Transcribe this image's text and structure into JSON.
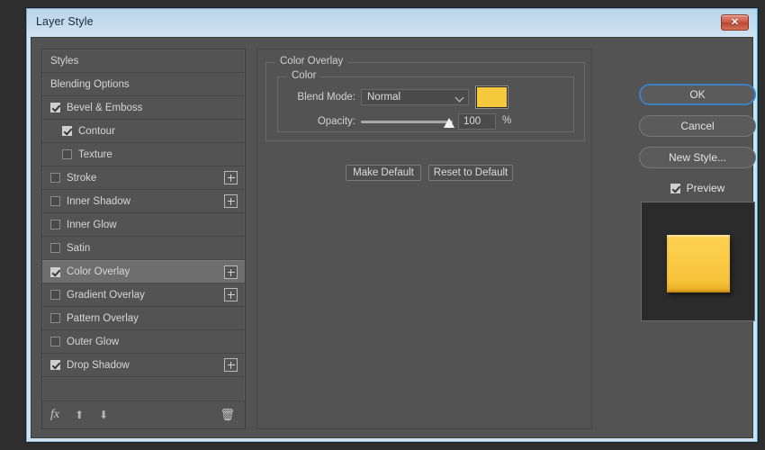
{
  "window": {
    "title": "Layer Style",
    "close_label": "✕"
  },
  "styles_panel": {
    "items": [
      {
        "label": "Styles",
        "checkbox": "none",
        "indent": false,
        "plus": false,
        "selected": false
      },
      {
        "label": "Blending Options",
        "checkbox": "none",
        "indent": false,
        "plus": false,
        "selected": false
      },
      {
        "label": "Bevel & Emboss",
        "checkbox": "checked",
        "indent": false,
        "plus": false,
        "selected": false
      },
      {
        "label": "Contour",
        "checkbox": "checked",
        "indent": true,
        "plus": false,
        "selected": false
      },
      {
        "label": "Texture",
        "checkbox": "unchecked",
        "indent": true,
        "plus": false,
        "selected": false
      },
      {
        "label": "Stroke",
        "checkbox": "unchecked",
        "indent": false,
        "plus": true,
        "selected": false
      },
      {
        "label": "Inner Shadow",
        "checkbox": "unchecked",
        "indent": false,
        "plus": true,
        "selected": false
      },
      {
        "label": "Inner Glow",
        "checkbox": "unchecked",
        "indent": false,
        "plus": false,
        "selected": false
      },
      {
        "label": "Satin",
        "checkbox": "unchecked",
        "indent": false,
        "plus": false,
        "selected": false
      },
      {
        "label": "Color Overlay",
        "checkbox": "checked",
        "indent": false,
        "plus": true,
        "selected": true
      },
      {
        "label": "Gradient Overlay",
        "checkbox": "unchecked",
        "indent": false,
        "plus": true,
        "selected": false
      },
      {
        "label": "Pattern Overlay",
        "checkbox": "unchecked",
        "indent": false,
        "plus": false,
        "selected": false
      },
      {
        "label": "Outer Glow",
        "checkbox": "unchecked",
        "indent": false,
        "plus": false,
        "selected": false
      },
      {
        "label": "Drop Shadow",
        "checkbox": "checked",
        "indent": false,
        "plus": true,
        "selected": false
      }
    ],
    "toolbar": {
      "fx_icon": "fx",
      "up_icon": "⬆",
      "down_icon": "⬇",
      "trash_icon": "🗑"
    }
  },
  "content": {
    "group_title": "Color Overlay",
    "subgroup_title": "Color",
    "blend_mode_label": "Blend Mode:",
    "blend_mode_value": "Normal",
    "blend_mode_options": [
      "Normal"
    ],
    "color_swatch_hex": "#F6C83C",
    "opacity_label": "Opacity:",
    "opacity_value": "100",
    "opacity_unit": "%",
    "opacity_percent": 100,
    "make_default_label": "Make Default",
    "reset_default_label": "Reset to Default"
  },
  "right": {
    "ok_label": "OK",
    "cancel_label": "Cancel",
    "new_style_label": "New Style...",
    "preview_label": "Preview",
    "preview_checked": true
  }
}
